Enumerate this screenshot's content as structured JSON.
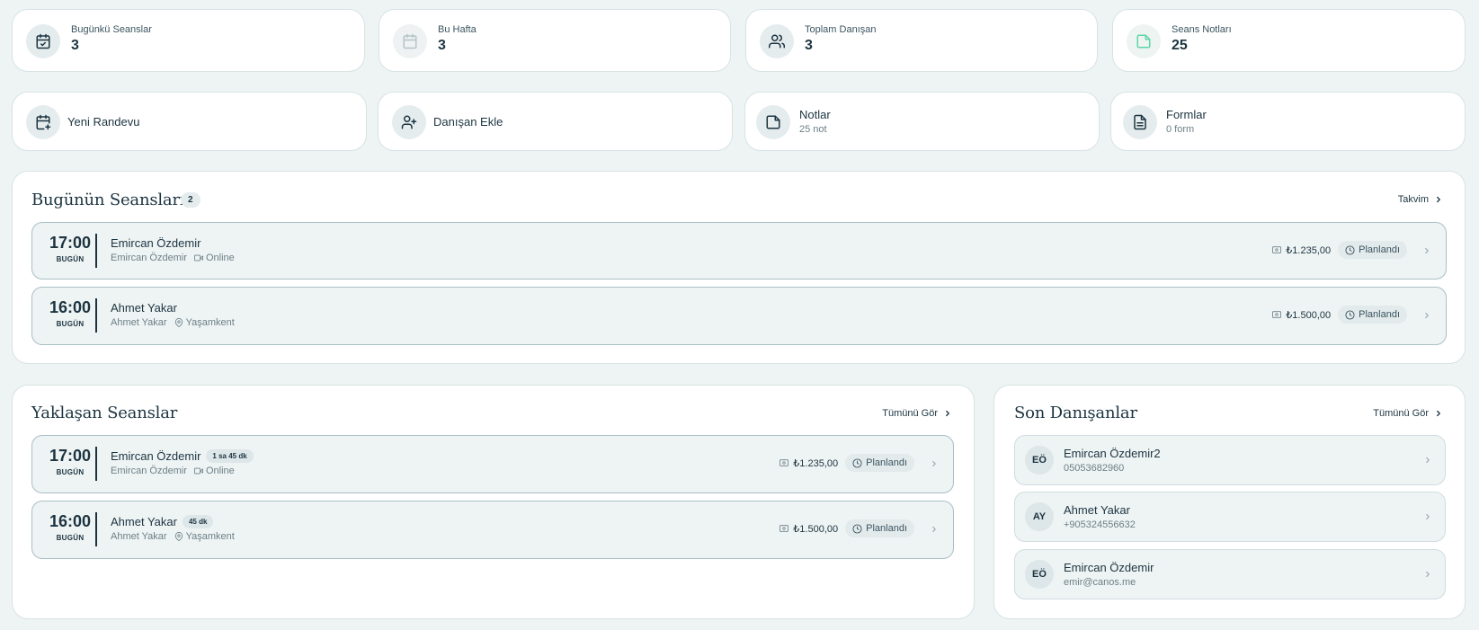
{
  "stats": [
    {
      "label": "Bugünkü Seanslar",
      "value": "3",
      "icon": "calendar-check-icon"
    },
    {
      "label": "Bu Hafta",
      "value": "3",
      "icon": "calendar-icon"
    },
    {
      "label": "Toplam Danışan",
      "value": "3",
      "icon": "users-icon"
    },
    {
      "label": "Seans Notları",
      "value": "25",
      "icon": "note-icon"
    }
  ],
  "actions": [
    {
      "title": "Yeni Randevu",
      "sub": "",
      "icon": "calendar-plus-icon"
    },
    {
      "title": "Danışan Ekle",
      "sub": "",
      "icon": "user-plus-icon"
    },
    {
      "title": "Notlar",
      "sub": "25 not",
      "icon": "note-icon"
    },
    {
      "title": "Formlar",
      "sub": "0 form",
      "icon": "file-text-icon"
    }
  ],
  "today": {
    "title": "Bugünün Seansları",
    "count": "2",
    "link": "Takvim",
    "sessions": [
      {
        "time": "17:00",
        "day": "BUGÜN",
        "name": "Emircan Özdemir",
        "client": "Emircan Özdemir",
        "location": "Online",
        "price": "₺1.235,00",
        "status": "Planlandı"
      },
      {
        "time": "16:00",
        "day": "BUGÜN",
        "name": "Ahmet Yakar",
        "client": "Ahmet Yakar",
        "location": "Yaşamkent",
        "price": "₺1.500,00",
        "status": "Planlandı"
      }
    ]
  },
  "upcoming": {
    "title": "Yaklaşan Seanslar",
    "link": "Tümünü Gör",
    "sessions": [
      {
        "time": "17:00",
        "day": "BUGÜN",
        "name": "Emircan Özdemir",
        "duration": "1 sa 45 dk",
        "client": "Emircan Özdemir",
        "location": "Online",
        "price": "₺1.235,00",
        "status": "Planlandı"
      },
      {
        "time": "16:00",
        "day": "BUGÜN",
        "name": "Ahmet Yakar",
        "duration": "45 dk",
        "client": "Ahmet Yakar",
        "location": "Yaşamkent",
        "price": "₺1.500,00",
        "status": "Planlandı"
      }
    ]
  },
  "recent": {
    "title": "Son Danışanlar",
    "link": "Tümünü Gör",
    "clients": [
      {
        "initials": "EÖ",
        "name": "Emircan Özdemir2",
        "sub": "05053682960"
      },
      {
        "initials": "AY",
        "name": "Ahmet Yakar",
        "sub": "+905324556632"
      },
      {
        "initials": "EÖ",
        "name": "Emircan Özdemir",
        "sub": "emir@canos.me"
      }
    ]
  }
}
